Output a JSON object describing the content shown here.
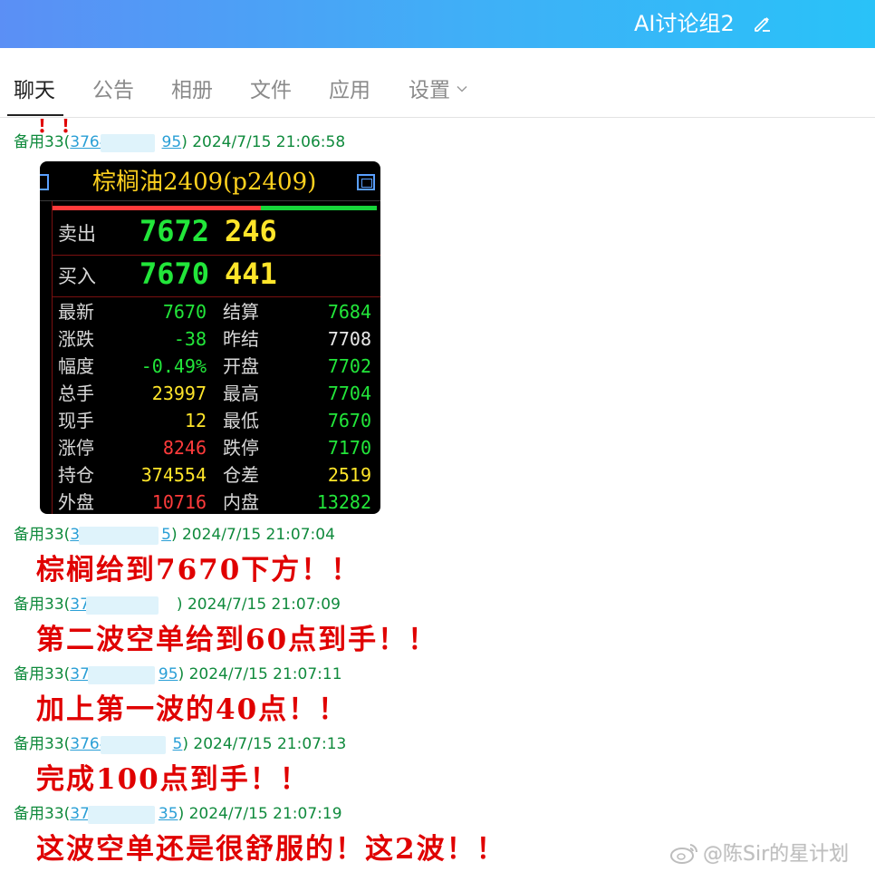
{
  "window": {
    "title": "AI讨论组2"
  },
  "tabs": [
    {
      "label": "聊天",
      "active": true
    },
    {
      "label": "公告",
      "active": false
    },
    {
      "label": "相册",
      "active": false
    },
    {
      "label": "文件",
      "active": false
    },
    {
      "label": "应用",
      "active": false
    },
    {
      "label": "设置",
      "active": false
    }
  ],
  "chat": {
    "cutoff_text": "！！",
    "messages": [
      {
        "sender": "备用33",
        "uid_visible_start": "3764",
        "uid_visible_end": "95",
        "timestamp": "2024/7/15 21:06:58",
        "type": "image"
      },
      {
        "sender": "备用33",
        "uid_visible_start": "3",
        "uid_visible_end": "5",
        "timestamp": "2024/7/15 21:07:04",
        "text": "棕榈给到7670下方！！"
      },
      {
        "sender": "备用33",
        "uid_visible_start": "37",
        "uid_visible_end": "",
        "timestamp": "2024/7/15 21:07:09",
        "text": "第二波空单给到60点到手！！"
      },
      {
        "sender": "备用33",
        "uid_visible_start": "37",
        "uid_visible_end": "95",
        "timestamp": "2024/7/15 21:07:11",
        "text": "加上第一波的40点！！"
      },
      {
        "sender": "备用33",
        "uid_visible_start": "3764",
        "uid_visible_end": "5",
        "timestamp": "2024/7/15 21:07:13",
        "text": "完成100点到手！！"
      },
      {
        "sender": "备用33",
        "uid_visible_start": "37",
        "uid_visible_end": "35",
        "timestamp": "2024/7/15 21:07:19",
        "text": "这波空单还是很舒服的！这2波！！"
      }
    ]
  },
  "quote_card": {
    "title": "棕榈油2409(p2409)",
    "sell_label": "卖出",
    "sell_price": "7672",
    "sell_volume": "246",
    "buy_label": "买入",
    "buy_price": "7670",
    "buy_volume": "441",
    "rows": [
      {
        "l_label": "最新",
        "l_value": "7670",
        "l_color": "#22e63a",
        "r_label": "结算",
        "r_value": "7684",
        "r_color": "#22e63a"
      },
      {
        "l_label": "涨跌",
        "l_value": "-38",
        "l_color": "#22e63a",
        "r_label": "昨结",
        "r_value": "7708",
        "r_color": "#e8e8e8"
      },
      {
        "l_label": "幅度",
        "l_value": "-0.49%",
        "l_color": "#22e63a",
        "r_label": "开盘",
        "r_value": "7702",
        "r_color": "#22e63a"
      },
      {
        "l_label": "总手",
        "l_value": "23997",
        "l_color": "#ffe52a",
        "r_label": "最高",
        "r_value": "7704",
        "r_color": "#22e63a"
      },
      {
        "l_label": "现手",
        "l_value": "12",
        "l_color": "#ffe52a",
        "r_label": "最低",
        "r_value": "7670",
        "r_color": "#22e63a"
      },
      {
        "l_label": "涨停",
        "l_value": "8246",
        "l_color": "#ff3b3b",
        "r_label": "跌停",
        "r_value": "7170",
        "r_color": "#22e63a"
      },
      {
        "l_label": "持仓",
        "l_value": "374554",
        "l_color": "#ffe52a",
        "r_label": "仓差",
        "r_value": "2519",
        "r_color": "#ffe52a"
      },
      {
        "l_label": "外盘",
        "l_value": "10716",
        "l_color": "#ff3b3b",
        "r_label": "内盘",
        "r_value": "13282",
        "r_color": "#22e63a"
      }
    ]
  },
  "watermark": {
    "text": "@陈Sir的星计划"
  },
  "icons": {
    "edit": "pencil-icon",
    "settings_dropdown": "chevron-down-icon",
    "watermark_logo": "weibo-logo"
  },
  "colors": {
    "titlebar_start": "#5b8ff5",
    "titlebar_end": "#29c2f8",
    "meta_green": "#0f8a3c",
    "uid_link": "#2a9fd6",
    "message_red": "#e00000"
  }
}
